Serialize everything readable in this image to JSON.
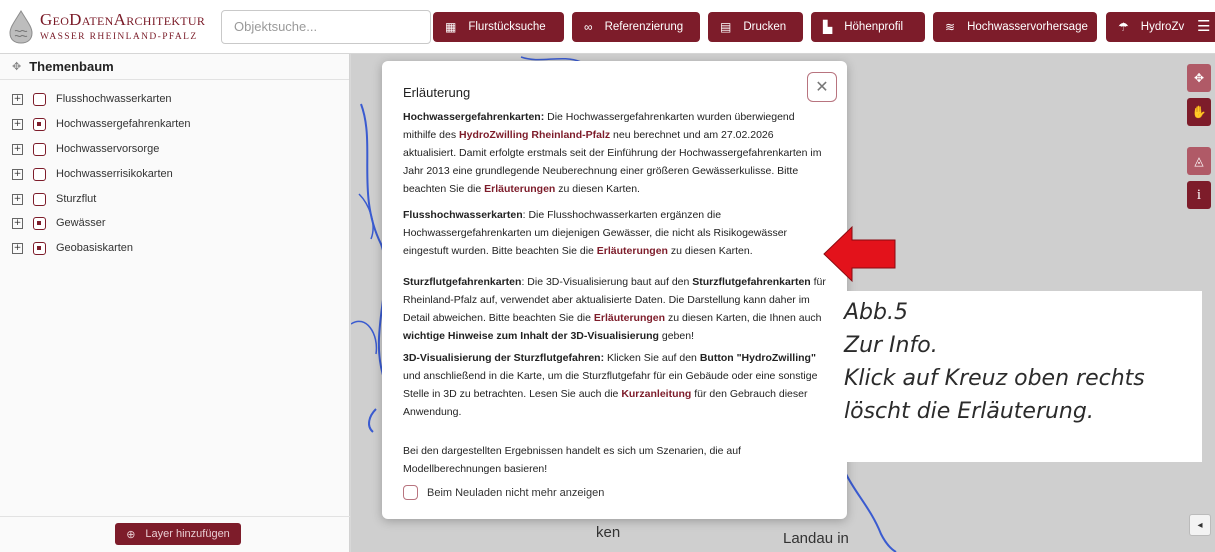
{
  "header": {
    "logo": {
      "line1": "GeoDatenArchitektur",
      "line2": "WASSER RHEINLAND-PFALZ"
    },
    "search": {
      "placeholder": "Objektsuche..."
    },
    "tools": [
      {
        "label": "Flurstücksuche",
        "icon": "parcel-search-icon"
      },
      {
        "label": "Referenzierung",
        "icon": "link-icon"
      },
      {
        "label": "Drucken",
        "icon": "print-icon"
      },
      {
        "label": "Höhenprofil",
        "icon": "profile-chart-icon"
      },
      {
        "label": "Hochwasservorhersage",
        "icon": "forecast-icon"
      },
      {
        "label": "HydroZv",
        "icon": "umbrella-icon"
      }
    ],
    "menu_icon": "hamburger-icon",
    "accent_color": "#7d1c2a"
  },
  "sidebar": {
    "title": "Themenbaum",
    "items": [
      {
        "label": "Flusshochwasserkarten",
        "checked": "empty"
      },
      {
        "label": "Hochwassergefahrenkarten",
        "checked": "partial"
      },
      {
        "label": "Hochwasservorsorge",
        "checked": "empty"
      },
      {
        "label": "Hochwasserrisikokarten",
        "checked": "empty"
      },
      {
        "label": "Sturzflut",
        "checked": "empty"
      },
      {
        "label": "Gewässer",
        "checked": "partial"
      },
      {
        "label": "Geobasiskarten",
        "checked": "partial"
      }
    ],
    "add_layer_label": "Layer hinzufügen"
  },
  "map": {
    "labels": [
      "ken",
      "Landau in"
    ]
  },
  "modal": {
    "title": "Erläuterung",
    "paragraphs": {
      "p1": {
        "head": "Hochwassergefahrenkarten:",
        "t1": " Die Hochwassergefahrenkarten wurden überwiegend mithilfe des ",
        "link1": "HydroZwilling Rheinland-Pfalz",
        "t2": " neu berechnet und am 27.02.2026 aktualisiert. Damit erfolgte erstmals seit der Einführung der Hochwassergefahrenkarten im Jahr 2013 eine grundlegende Neuberechnung einer größeren Gewässerkulisse. Bitte beachten Sie die ",
        "link2": "Erläuterungen",
        "t3": " zu diesen Karten."
      },
      "p2": {
        "head": "Flusshochwasserkarten",
        "t1": ": Die Flusshochwasserkarten ergänzen die Hochwassergefahrenkarten um diejenigen Gewässer, die nicht als Risikogewässer eingestuft wurden. Bitte beachten Sie die ",
        "link1": "Erläuterungen",
        "t2": " zu diesen Karten."
      },
      "p3": {
        "head": "Sturzflutgefahrenkarten",
        "t1": ": Die 3D-Visualisierung baut auf den ",
        "bold1": "Sturzflutgefahrenkarten",
        "t2": " für Rheinland-Pfalz auf, verwendet aber aktualisierte Daten. Die Darstellung kann daher im Detail abweichen. Bitte beachten Sie die ",
        "link1": "Erläuterungen",
        "t3": " zu diesen Karten, die Ihnen auch ",
        "bold2": "wichtige Hinweise zum Inhalt der 3D-Visualisierung",
        "t4": " geben!"
      },
      "p4": {
        "head": "3D-Visualisierung der Sturzflutgefahren:",
        "t1": " Klicken Sie auf den ",
        "bold1": "Button \"HydroZwilling\"",
        "t2": " und anschließend in die Karte, um die Sturzflutgefahr für ein Gebäude oder eine sonstige Stelle in 3D zu betrachten. Lesen Sie auch die ",
        "link1": "Kurzanleitung",
        "t3": " für den Gebrauch dieser Anwendung."
      },
      "p5": {
        "t1": "Bei den dargestellten Ergebnissen handelt es sich um Szenarien, die auf Modellberechnungen basieren!"
      }
    },
    "dont_show_label": "Beim Neuladen nicht mehr anzeigen",
    "close_icon": "close-icon"
  },
  "annotation": {
    "lines": [
      "Abb.5",
      "Zur Info.",
      "Klick auf Kreuz oben rechts",
      "löscht die Erläuterung."
    ],
    "arrow_color": "#e3121b"
  }
}
